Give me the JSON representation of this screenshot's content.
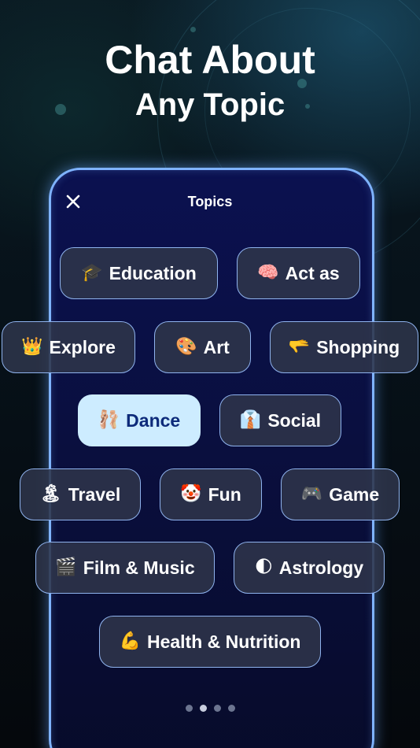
{
  "headline": {
    "line1": "Chat About",
    "line2": "Any Topic"
  },
  "modal": {
    "title": "Topics",
    "close_icon": "close-icon"
  },
  "chips": [
    {
      "emoji": "🎓",
      "label": "Education",
      "selected": false
    },
    {
      "emoji": "🧠",
      "label": "Act as",
      "selected": false
    },
    {
      "emoji": "👑",
      "label": "Explore",
      "selected": false
    },
    {
      "emoji": "🎨",
      "label": "Art",
      "selected": false
    },
    {
      "emoji": "🫳",
      "label": "Shopping",
      "selected": false
    },
    {
      "emoji": "🩰",
      "label": "Dance",
      "selected": true
    },
    {
      "emoji": "👔",
      "label": "Social",
      "selected": false
    },
    {
      "emoji": "🏝",
      "label": "Travel",
      "selected": false
    },
    {
      "emoji": "🤡",
      "label": "Fun",
      "selected": false
    },
    {
      "emoji": "🎮",
      "label": "Game",
      "selected": false
    },
    {
      "emoji": "🎬",
      "label": "Film & Music",
      "selected": false
    },
    {
      "emoji": "🌓",
      "label": "Astrology",
      "selected": false
    },
    {
      "emoji": "💪",
      "label": "Health & Nutrition",
      "selected": false
    }
  ],
  "pager": {
    "count": 4,
    "active_index": 1
  },
  "colors": {
    "chip_border": "#8fb3ee",
    "chip_selected_bg": "#cdecff",
    "chip_selected_text": "#0d2a7a",
    "phone_border": "#7fb3ff"
  }
}
